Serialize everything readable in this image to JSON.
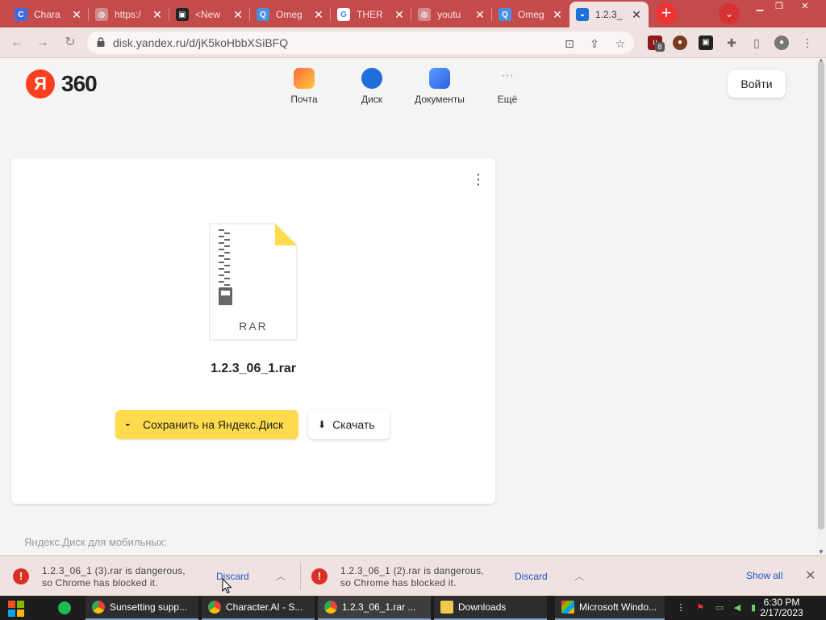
{
  "browser": {
    "tabs": [
      {
        "title": "Chara",
        "icon": "character-ai-icon",
        "icon_color": "#3c6ddb",
        "glyph": "C"
      },
      {
        "title": "https:/",
        "icon": "globe-icon",
        "icon_color": "#d28a8a",
        "glyph": "◍"
      },
      {
        "title": "<New",
        "icon": "tabnine-icon",
        "icon_color": "#222222",
        "glyph": "▣"
      },
      {
        "title": "Omeg",
        "icon": "omegle-icon",
        "icon_color": "#4a90e2",
        "glyph": "Q"
      },
      {
        "title": "THER",
        "icon": "google-icon",
        "icon_color": "#ffffff",
        "glyph": "G"
      },
      {
        "title": "youtu",
        "icon": "globe-icon",
        "icon_color": "#d28a8a",
        "glyph": "◍"
      },
      {
        "title": "Omeg",
        "icon": "omegle-icon",
        "icon_color": "#4a90e2",
        "glyph": "Q"
      },
      {
        "title": "1.2.3_",
        "icon": "yandex-disk-icon",
        "icon_color": "#1e6fd9",
        "glyph": "◒",
        "active": true
      }
    ],
    "new_tab_symbol": "+",
    "tab_search_symbol": "⌄",
    "url": "disk.yandex.ru/d/jK5koHbbXSiBFQ",
    "extension_badge": "8"
  },
  "page": {
    "brand": {
      "ya": "Я",
      "num": "360"
    },
    "services": [
      {
        "label": "Почта",
        "icon": "mail-icon",
        "color": "#fdb347"
      },
      {
        "label": "Диск",
        "icon": "disk-icon",
        "color": "#1e6fd9"
      },
      {
        "label": "Документы",
        "icon": "documents-icon",
        "color": "#3b7cf0"
      },
      {
        "label": "Ещё",
        "icon": "more-icon",
        "color": "#9e9e9e"
      }
    ],
    "login_label": "Войти",
    "file": {
      "type_label": "RAR",
      "name": "1.2.3_06_1.rar"
    },
    "save_label": "Сохранить на Яндекс.Диск",
    "download_label": "Скачать",
    "mobile_text": "Яндекс.Диск для мобильных:"
  },
  "download_bar": {
    "items": [
      {
        "message_line1": "1.2.3_06_1 (3).rar is dangerous,",
        "message_line2": "so Chrome has blocked it.",
        "discard": "Discard"
      },
      {
        "message_line1": "1.2.3_06_1 (2).rar is dangerous,",
        "message_line2": "so Chrome has blocked it.",
        "discard": "Discard"
      }
    ],
    "show_all": "Show all",
    "close": "✕"
  },
  "taskbar": {
    "apps": [
      {
        "label": "Sunsetting supp..."
      },
      {
        "label": "Character.AI - S..."
      },
      {
        "label": "1.2.3_06_1.rar ..."
      },
      {
        "label": "Downloads"
      },
      {
        "label": "Microsoft Windo..."
      }
    ],
    "time": "6:30 PM",
    "date": "2/17/2023"
  }
}
